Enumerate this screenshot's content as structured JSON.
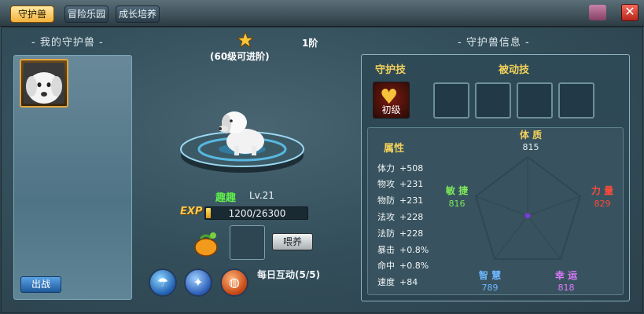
{
  "tabs": [
    {
      "label": "守护兽",
      "active": true
    },
    {
      "label": "冒险乐园",
      "active": false
    },
    {
      "label": "成长培养",
      "active": false
    }
  ],
  "left": {
    "title": "- 我的守护兽 -",
    "deploy_label": "出战"
  },
  "pet": {
    "stage": "1阶",
    "evolve_hint": "(60级可进阶)",
    "name": "趣趣",
    "level": "Lv.21",
    "exp_label": "EXP",
    "exp_text": "1200/26300",
    "exp_current": 1200,
    "exp_max": 26300,
    "feed_label": "喂养",
    "daily": "每日互动(5/5)"
  },
  "right": {
    "title": "- 守护兽信息 -",
    "guard_skill_head": "守护技",
    "passive_skill_head": "被动技",
    "guard_skill_level": "初级",
    "attr_title": "属性",
    "stats": [
      {
        "label": "体力",
        "value": "+508"
      },
      {
        "label": "物攻",
        "value": "+231"
      },
      {
        "label": "物防",
        "value": "+231"
      },
      {
        "label": "法攻",
        "value": "+228"
      },
      {
        "label": "法防",
        "value": "+228"
      },
      {
        "label": "暴击",
        "value": "+0.8%"
      },
      {
        "label": "命中",
        "value": "+0.8%"
      },
      {
        "label": "速度",
        "value": "+84"
      }
    ],
    "radar": {
      "constitution": {
        "label": "体 质",
        "value": "815",
        "color": "#f3d15a"
      },
      "power": {
        "label": "力 量",
        "value": "829",
        "color": "#ff4a3a"
      },
      "agility": {
        "label": "敏 捷",
        "value": "816",
        "color": "#7ee85a"
      },
      "intellect": {
        "label": "智 慧",
        "value": "789",
        "color": "#6fb7ff"
      },
      "luck": {
        "label": "幸 运",
        "value": "818",
        "color": "#e07bff"
      }
    }
  },
  "close_label": "✕"
}
